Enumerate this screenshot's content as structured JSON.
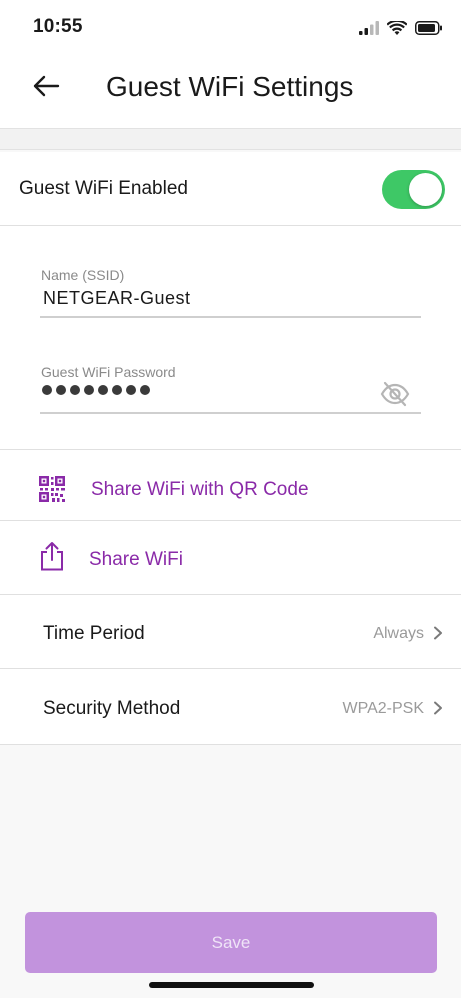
{
  "status_bar": {
    "time": "10:55",
    "icons": [
      "cellular-signal-icon",
      "wifi-icon",
      "battery-icon"
    ]
  },
  "header": {
    "title": "Guest WiFi Settings",
    "back_icon": "back-arrow-icon"
  },
  "guest_wifi": {
    "enabled_label": "Guest WiFi Enabled",
    "enabled": true,
    "toggle_color": "#3ec866"
  },
  "form": {
    "ssid_label": "Name (SSID)",
    "ssid_value": "NETGEAR-Guest",
    "password_label": "Guest WiFi Password",
    "password_masked_length": 8,
    "password_visibility_icon": "eye-off-icon"
  },
  "actions": {
    "share_qr_label": "Share WiFi with QR Code",
    "share_qr_icon": "qr-code-icon",
    "share_wifi_label": "Share WiFi",
    "share_wifi_icon": "share-icon",
    "accent_color": "#8a2aa8"
  },
  "settings": {
    "time_period_label": "Time Period",
    "time_period_value": "Always",
    "security_method_label": "Security Method",
    "security_method_value": "WPA2-PSK"
  },
  "footer": {
    "save_label": "Save",
    "save_button_color": "#c293dd"
  }
}
